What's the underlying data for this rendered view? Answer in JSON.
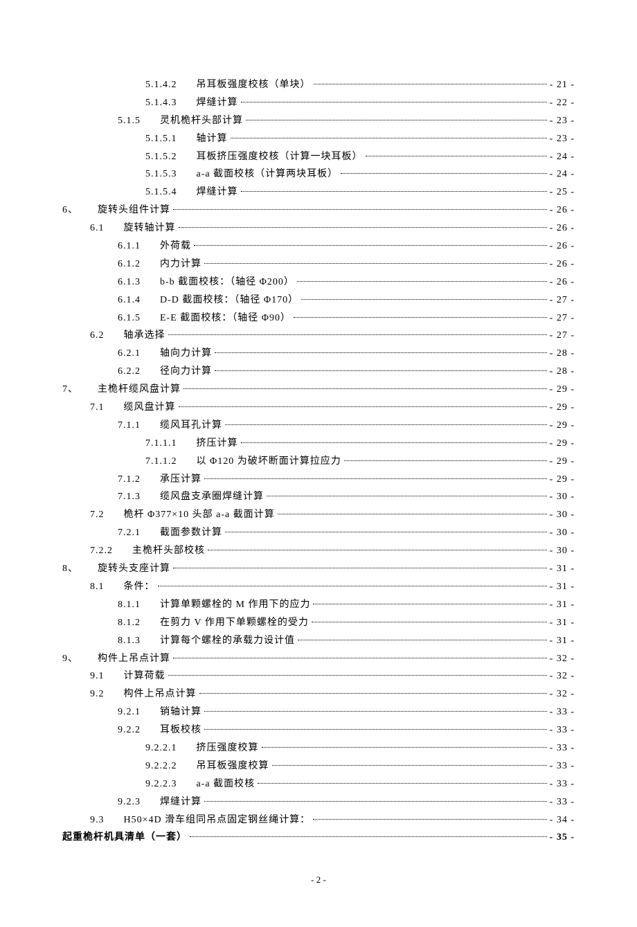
{
  "toc": [
    {
      "indent": 4,
      "num": "5.1.4.2",
      "title": "吊耳板强度校核（单块）",
      "page": "- 21 -"
    },
    {
      "indent": 4,
      "num": "5.1.4.3",
      "title": "焊缝计算",
      "page": "- 22 -"
    },
    {
      "indent": 3,
      "num": "5.1.5",
      "title": "灵机桅杆头部计算",
      "page": "- 23 -"
    },
    {
      "indent": 4,
      "num": "5.1.5.1",
      "title": "轴计算",
      "page": "- 23 -"
    },
    {
      "indent": 4,
      "num": "5.1.5.2",
      "title": "耳板挤压强度校核（计算一块耳板）",
      "page": "- 24 -"
    },
    {
      "indent": 4,
      "num": "5.1.5.3",
      "title": "a-a 截面校核（计算两块耳板）",
      "page": "- 24 -"
    },
    {
      "indent": 4,
      "num": "5.1.5.4",
      "title": "焊缝计算",
      "page": "- 25 -"
    },
    {
      "indent": 1,
      "num": "6、",
      "title": "旋转头组件计算",
      "page": "- 26 -"
    },
    {
      "indent": 2,
      "num": "6.1",
      "title": "旋转轴计算",
      "page": "- 26 -"
    },
    {
      "indent": 3,
      "num": "6.1.1",
      "title": "外荷载",
      "page": "- 26 -"
    },
    {
      "indent": 3,
      "num": "6.1.2",
      "title": "内力计算",
      "page": "- 26 -"
    },
    {
      "indent": 3,
      "num": "6.1.3",
      "title": "b-b 截面校核：（轴径 Φ200）",
      "page": "- 26 -"
    },
    {
      "indent": 3,
      "num": "6.1.4",
      "title": "D-D 截面校核：（轴径 Φ170）",
      "page": "- 27 -"
    },
    {
      "indent": 3,
      "num": "6.1.5",
      "title": "E-E 截面校核：（轴径 Φ90）",
      "page": "- 27 -"
    },
    {
      "indent": 2,
      "num": "6.2",
      "title": "轴承选择",
      "page": "- 27 -"
    },
    {
      "indent": 3,
      "num": "6.2.1",
      "title": "轴向力计算",
      "page": "- 28 -"
    },
    {
      "indent": 3,
      "num": "6.2.2",
      "title": "径向力计算",
      "page": "- 28 -"
    },
    {
      "indent": 1,
      "num": "7、",
      "title": "主桅杆缆风盘计算",
      "page": "- 29 -"
    },
    {
      "indent": 2,
      "num": "7.1",
      "title": "缆风盘计算",
      "page": "- 29 -"
    },
    {
      "indent": 3,
      "num": "7.1.1",
      "title": "缆风耳孔计算",
      "page": "- 29 -"
    },
    {
      "indent": 4,
      "num": "7.1.1.1",
      "title": "挤压计算",
      "page": "- 29 -"
    },
    {
      "indent": 4,
      "num": "7.1.1.2",
      "title": "以 Φ120 为破坏断面计算拉应力",
      "page": "- 29 -"
    },
    {
      "indent": 3,
      "num": "7.1.2",
      "title": "承压计算",
      "page": "- 29 -"
    },
    {
      "indent": 3,
      "num": "7.1.3",
      "title": "缆风盘支承圈焊缝计算",
      "page": "- 30 -"
    },
    {
      "indent": 2,
      "num": "7.2",
      "title": "桅杆 Φ377×10 头部 a-a 截面计算",
      "page": "- 30 -"
    },
    {
      "indent": 3,
      "num": "7.2.1",
      "title": "截面参数计算",
      "page": "- 30 -"
    },
    {
      "indent": "3b",
      "num": "7.2.2",
      "title": "主桅杆头部校核",
      "page": "- 30 -"
    },
    {
      "indent": 1,
      "num": "8、",
      "title": "旋转头支座计算",
      "page": "- 31 -"
    },
    {
      "indent": 2,
      "num": "8.1",
      "title": "条件：",
      "page": "- 31 -"
    },
    {
      "indent": 3,
      "num": "8.1.1",
      "title": "计算单颗螺栓的 M 作用下的应力",
      "page": "- 31 -"
    },
    {
      "indent": 3,
      "num": "8.1.2",
      "title": "在剪力 V 作用下单颗螺栓的受力",
      "page": "- 31 -"
    },
    {
      "indent": 3,
      "num": "8.1.3",
      "title": "计算每个螺栓的承载力设计值",
      "page": "- 31 -"
    },
    {
      "indent": 1,
      "num": "9、",
      "title": "构件上吊点计算",
      "page": "- 32 -"
    },
    {
      "indent": 2,
      "num": "9.1",
      "title": "计算荷载",
      "page": "- 32 -"
    },
    {
      "indent": 2,
      "num": "9.2",
      "title": "构件上吊点计算",
      "page": "- 32 -"
    },
    {
      "indent": 3,
      "num": "9.2.1",
      "title": "销轴计算",
      "page": "- 33 -"
    },
    {
      "indent": 3,
      "num": "9.2.2",
      "title": "耳板校核",
      "page": "- 33 -"
    },
    {
      "indent": 4,
      "num": "9.2.2.1",
      "title": "挤压强度校算",
      "page": "- 33 -"
    },
    {
      "indent": 4,
      "num": "9.2.2.2",
      "title": "吊耳板强度校算",
      "page": "- 33 -"
    },
    {
      "indent": 4,
      "num": "9.2.2.3",
      "title": "a-a 截面校核",
      "page": "- 33 -"
    },
    {
      "indent": 3,
      "num": "9.2.3",
      "title": "焊缝计算",
      "page": "- 33 -"
    },
    {
      "indent": 2,
      "num": "9.3",
      "title": "H50×4D 滑车组同吊点固定钢丝绳计算：",
      "page": "- 34 -"
    },
    {
      "indent": 0,
      "num": "",
      "title": "起重桅杆机具清单（一套）",
      "page": "- 35 -"
    }
  ],
  "pager": "- 2 -"
}
